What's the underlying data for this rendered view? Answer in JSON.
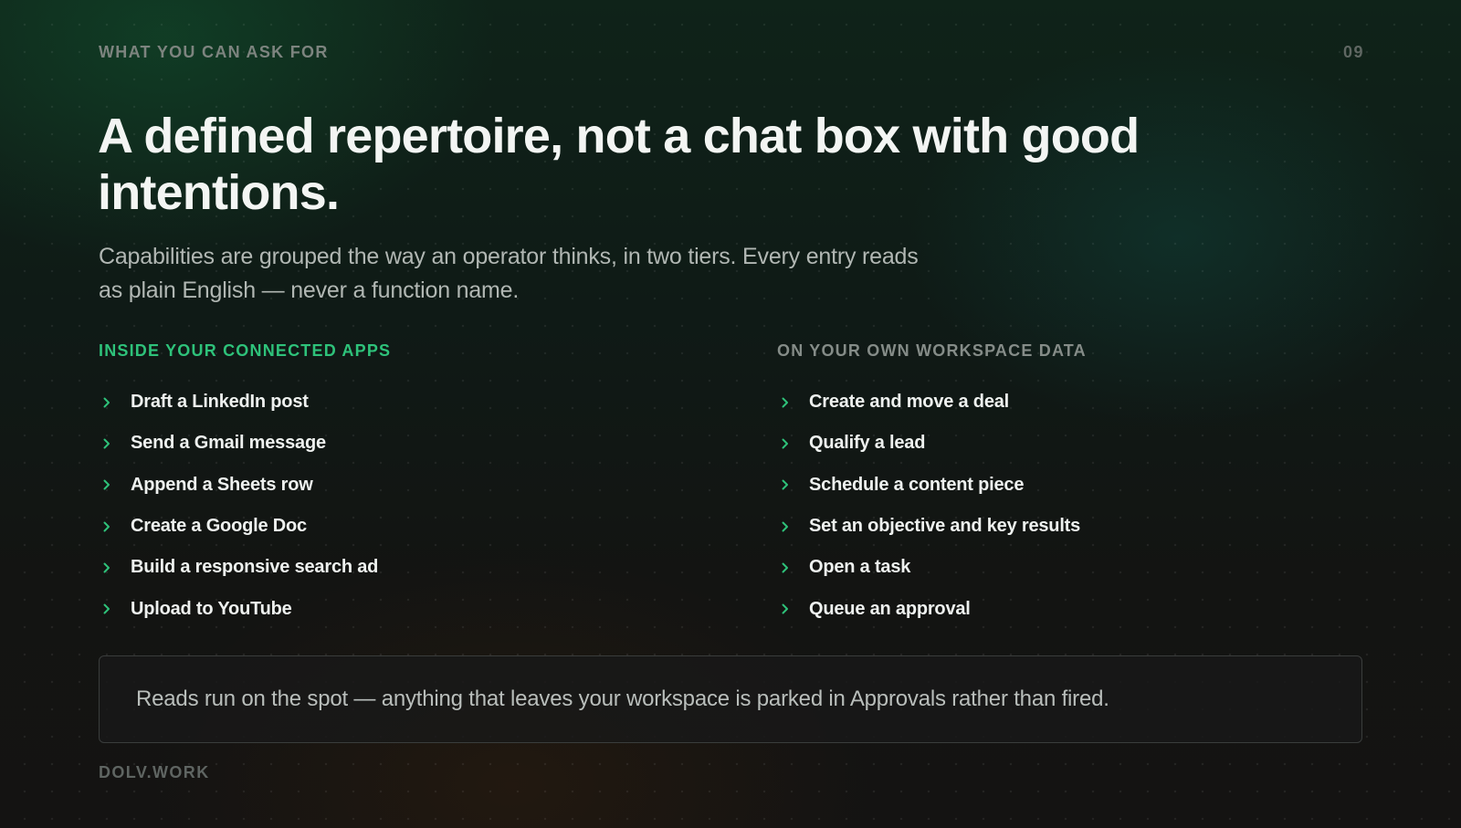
{
  "header": {
    "eyebrow": "WHAT YOU CAN ASK FOR",
    "page_number": "09"
  },
  "headline": "A defined repertoire, not a chat box with good intentions.",
  "subtitle": "Capabilities are grouped the way an operator thinks, in two tiers. Every entry reads as plain English — never a function name.",
  "columns": [
    {
      "title": "INSIDE YOUR CONNECTED APPS",
      "items": [
        {
          "label": "Draft a LinkedIn post"
        },
        {
          "label": "Send a Gmail message"
        },
        {
          "label": "Append a Sheets row"
        },
        {
          "label": "Create a Google Doc"
        },
        {
          "label": "Build a responsive search ad"
        },
        {
          "label": "Upload to YouTube"
        }
      ]
    },
    {
      "title": "ON YOUR OWN WORKSPACE DATA",
      "items": [
        {
          "label": "Create and move a deal"
        },
        {
          "label": "Qualify a lead"
        },
        {
          "label": "Schedule a content piece"
        },
        {
          "label": "Set an objective and key results"
        },
        {
          "label": "Open a task"
        },
        {
          "label": "Queue an approval"
        }
      ]
    }
  ],
  "callout": "Reads run on the spot — anything that leaves your workspace is parked in Approvals rather than fired.",
  "footer": {
    "brand": "DOLV.WORK"
  },
  "colors": {
    "accent_green": "#2ec27a",
    "muted_title": "#858c88",
    "headline": "#f3f5f3"
  },
  "icons": {
    "bullet": "chevron-right-icon"
  }
}
